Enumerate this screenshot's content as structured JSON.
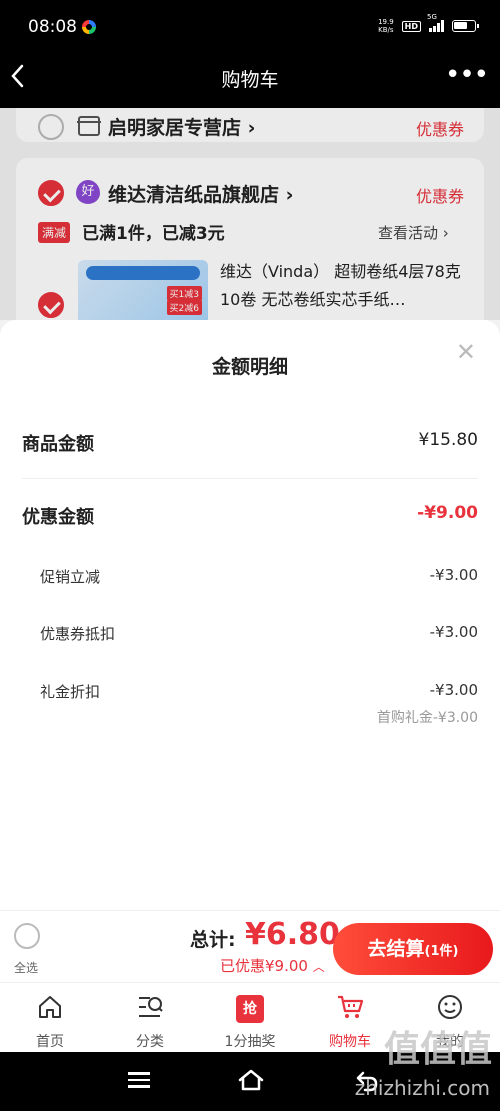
{
  "status_bar": {
    "time": "08:08",
    "net_speed_top": "19.9",
    "net_speed_bottom": "KB/s",
    "hd": "HD",
    "signal": "5G"
  },
  "header": {
    "title": "购物车"
  },
  "cart": {
    "shop1": {
      "name": "启明家居专营店",
      "coupon": "优惠券"
    },
    "shop2": {
      "name": "维达清洁纸品旗舰店",
      "badge": "好",
      "coupon": "优惠券",
      "promo_tag": "满减",
      "promo_text": "已满1件，已减3元",
      "view_activity": "查看活动",
      "product_title": "维达（Vinda） 超韧卷纸4层78克10卷 无芯卷纸实芯手纸…",
      "image_badges": [
        "买1减3",
        "买2减6"
      ]
    }
  },
  "sheet": {
    "title": "金额明细",
    "goods_label": "商品金额",
    "goods_amount": "¥15.80",
    "discount_label": "优惠金额",
    "discount_amount": "-¥9.00",
    "items": [
      {
        "label": "促销立减",
        "amount": "-¥3.00"
      },
      {
        "label": "优惠券抵扣",
        "amount": "-¥3.00"
      },
      {
        "label": "礼金折扣",
        "amount": "-¥3.00",
        "note": "首购礼金-¥3.00"
      }
    ]
  },
  "checkout": {
    "select_all": "全选",
    "total_label": "总计:",
    "total_value": "¥6.80",
    "saved": "已优惠¥9.00",
    "pay_button": "去结算",
    "pay_count": "(1件)"
  },
  "tabs": [
    {
      "label": "首页",
      "icon": "home-icon"
    },
    {
      "label": "分类",
      "icon": "category-icon"
    },
    {
      "label": "1分抽奖",
      "icon": "lottery-icon",
      "glyph": "抢"
    },
    {
      "label": "购物车",
      "icon": "cart-icon",
      "active": true
    },
    {
      "label": "我的",
      "icon": "profile-icon"
    }
  ],
  "watermark": {
    "text": "值值值",
    "url": "zhizhizhi.com"
  },
  "colors": {
    "accent": "#e8323c",
    "background": "#f2f2f2"
  }
}
